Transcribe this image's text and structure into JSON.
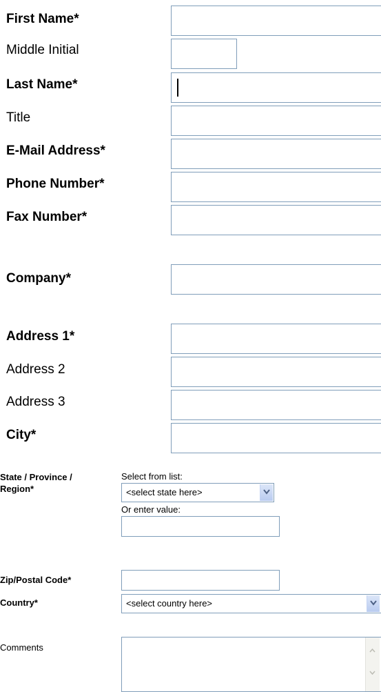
{
  "form": {
    "first_name_label": "First Name*",
    "middle_initial_label": "Middle Initial",
    "last_name_label": "Last Name*",
    "title_label": "Title",
    "email_label": "E-Mail Address*",
    "phone_label": "Phone Number*",
    "fax_label": "Fax Number*",
    "company_label": "Company*",
    "address1_label": "Address 1*",
    "address2_label": "Address 2",
    "address3_label": "Address 3",
    "city_label": "City*",
    "state_label_line1": "State / Province /",
    "state_label_line2": "Region*",
    "select_from_list": "Select from list:",
    "state_select_value": "<select state here>",
    "or_enter_value": "Or enter value:",
    "zip_label": "Zip/Postal Code*",
    "country_label": "Country*",
    "country_select_value": "<select country here>",
    "comments_label": "Comments"
  },
  "icons": {
    "dropdown": "chevron-down-icon",
    "scroll_up": "scroll-up-arrow-icon",
    "scroll_down": "scroll-down-arrow-icon"
  },
  "colors": {
    "input_border": "#7f9db9",
    "dropdown_button": "#b9cbf0"
  }
}
